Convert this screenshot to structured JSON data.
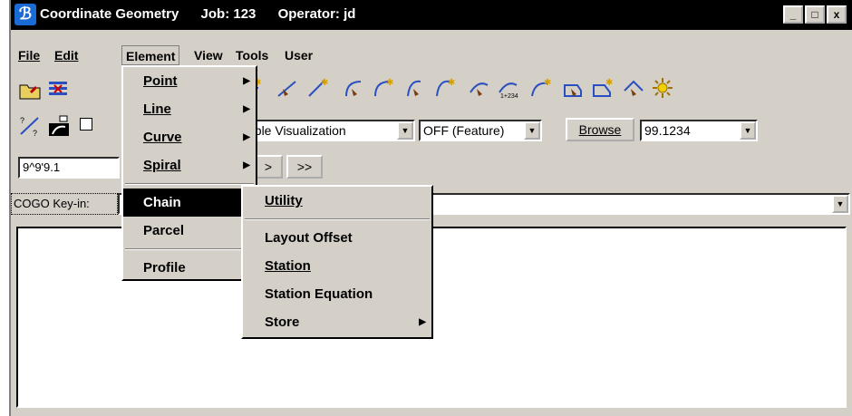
{
  "window": {
    "app_name": "Coordinate Geometry",
    "job": "Job: 123",
    "operator": "Operator: jd",
    "controls": {
      "minimize": "_",
      "maximize": "□",
      "close": "x"
    }
  },
  "menubar": [
    {
      "label": "File"
    },
    {
      "label": "Edit"
    },
    {
      "label": "Element"
    },
    {
      "label": "View"
    },
    {
      "label": "Tools"
    },
    {
      "label": "User"
    }
  ],
  "toolbar": {
    "visualization": "able Visualization",
    "feature_mode": "OFF (Feature)",
    "browse_label": "Browse",
    "value_combo": "99.1234",
    "nav_next": ">",
    "nav_last": ">>"
  },
  "entry_field": "9^9'9.1",
  "keyin": {
    "label": "COGO Key-in:"
  },
  "element_menu": [
    {
      "label": "Point"
    },
    {
      "label": "Line"
    },
    {
      "label": "Curve"
    },
    {
      "label": "Spiral"
    },
    {
      "label": "Chain"
    },
    {
      "label": "Parcel"
    },
    {
      "label": "Profile"
    }
  ],
  "chain_submenu": [
    {
      "label": "Utility"
    },
    {
      "label": "Layout Offset"
    },
    {
      "label": "Station"
    },
    {
      "label": "Station Equation"
    },
    {
      "label": "Store"
    }
  ],
  "icons": [
    "folder-open-icon",
    "list-delete-icon",
    "point-icon",
    "line-store-icon",
    "curve-icon",
    "arc-icon",
    "spiral-icon",
    "spiral-store-icon",
    "curve-station-icon",
    "chain-store-icon",
    "locate-icon",
    "parcel-icon",
    "profile-icon",
    "sun-icon",
    "point-visualize-icon",
    "chain-define-icon"
  ]
}
